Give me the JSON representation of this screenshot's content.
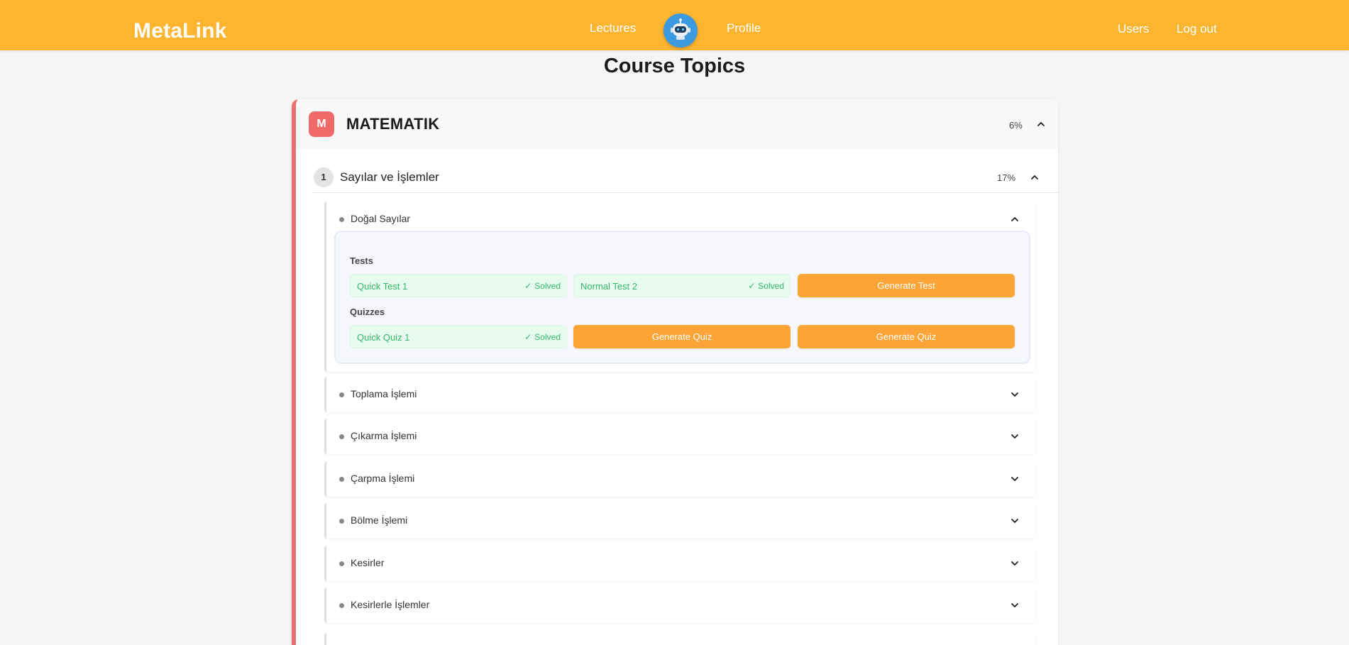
{
  "header": {
    "brand": "MetaLink",
    "nav": {
      "lectures": "Lectures",
      "profile": "Profile",
      "users": "Users",
      "logout": "Log out"
    },
    "bot_icon": "robot-icon"
  },
  "page": {
    "title": "Course Topics"
  },
  "course": {
    "badge": "M",
    "name": "MATEMATIK",
    "progress": "6%",
    "accent_color": "#f07070",
    "unit": {
      "number": "1",
      "name": "Sayılar ve İşlemler",
      "progress": "17%",
      "topics": [
        {
          "name": "Doğal Sayılar",
          "expanded": true,
          "tests_label": "Tests",
          "quizzes_label": "Quizzes",
          "tests": [
            {
              "name": "Quick Test 1",
              "status": "Solved"
            },
            {
              "name": "Normal Test 2",
              "status": "Solved"
            }
          ],
          "generate_test_label": "Generate Test",
          "quizzes": [
            {
              "name": "Quick Quiz 1",
              "status": "Solved"
            }
          ],
          "generate_quiz_labels": [
            "Generate Quiz",
            "Generate Quiz"
          ]
        },
        {
          "name": "Toplama İşlemi"
        },
        {
          "name": "Çıkarma İşlemi"
        },
        {
          "name": "Çarpma İşlemi"
        },
        {
          "name": "Bölme İşlemi"
        },
        {
          "name": "Kesirler"
        },
        {
          "name": "Kesirlerle İşlemler"
        }
      ]
    }
  },
  "colors": {
    "header_bg": "#fdb42f",
    "button_orange": "#fda436",
    "solved_green": "#35b86b",
    "solved_bg": "#e7fbee"
  }
}
